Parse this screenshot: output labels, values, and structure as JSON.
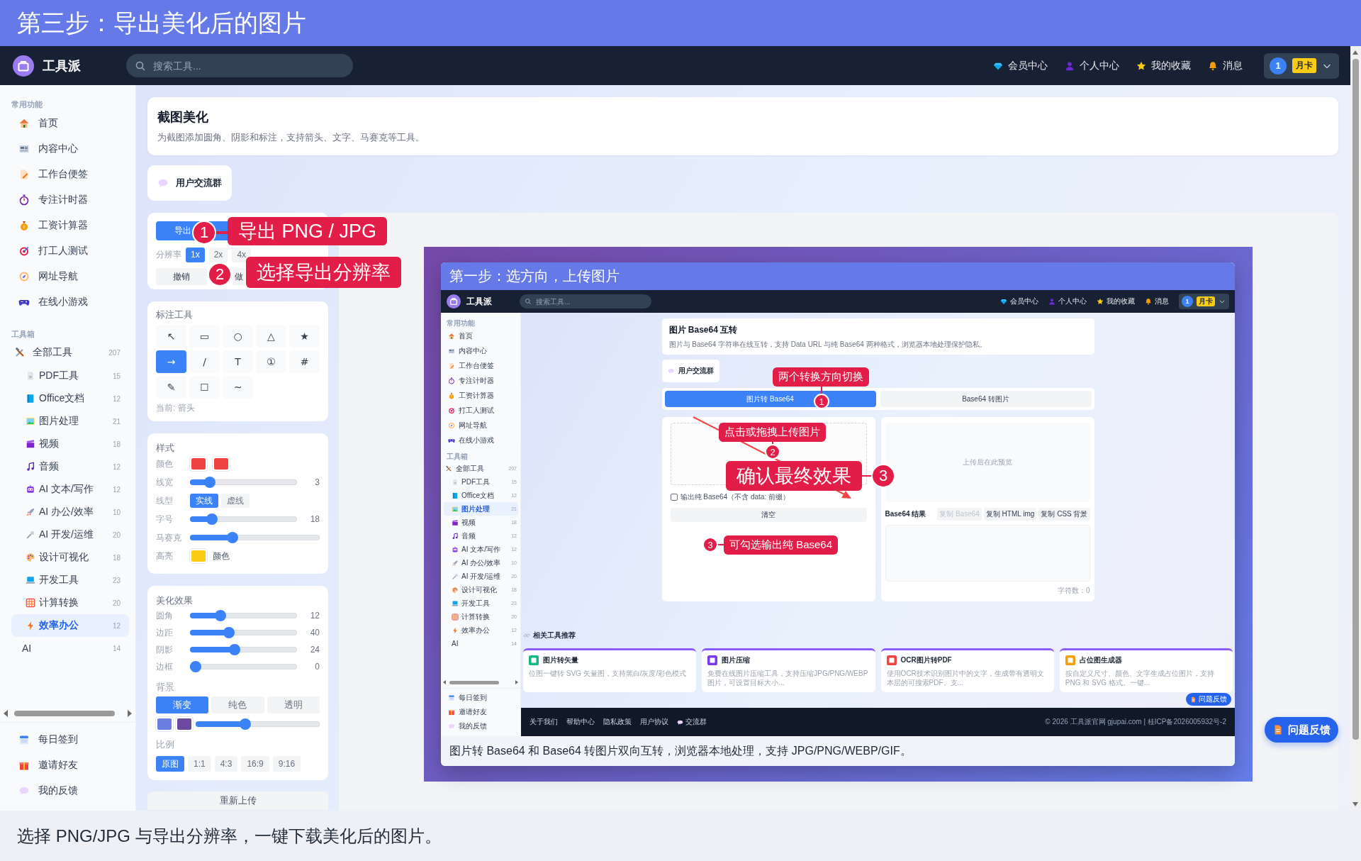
{
  "banner": {
    "title": "第三步：导出美化后的图片"
  },
  "app": {
    "brand": "工具派",
    "search": {
      "placeholder": "搜索工具..."
    },
    "nav": [
      "会员中心",
      "个人中心",
      "我的收藏",
      "消息"
    ],
    "user": {
      "avatar": "1",
      "badge": "月卡"
    }
  },
  "sidebar": {
    "sections": [
      {
        "heading": "常用功能",
        "items": [
          {
            "label": "首页",
            "selected": false
          },
          {
            "label": "内容中心",
            "selected": false
          },
          {
            "label": "工作台便签",
            "selected": false
          },
          {
            "label": "专注计时器",
            "selected": false
          },
          {
            "label": "工资计算器",
            "selected": false
          },
          {
            "label": "打工人测试",
            "selected": false
          },
          {
            "label": "网址导航",
            "selected": false
          },
          {
            "label": "在线小游戏",
            "selected": false
          }
        ]
      },
      {
        "heading": "工具箱",
        "items": [
          {
            "label": "全部工具",
            "count": "207",
            "selected": false,
            "children": [
              {
                "label": "PDF工具",
                "count": "15",
                "selected": false
              },
              {
                "label": "Office文档",
                "count": "12",
                "selected": false
              },
              {
                "label": "图片处理",
                "count": "21",
                "selected": false
              },
              {
                "label": "视频",
                "count": "18",
                "selected": false
              },
              {
                "label": "音频",
                "count": "12",
                "selected": false
              },
              {
                "label": "AI 文本/写作",
                "count": "12",
                "selected": false
              },
              {
                "label": "AI 办公/效率",
                "count": "10",
                "selected": false
              },
              {
                "label": "AI 开发/运维",
                "count": "20",
                "selected": false
              },
              {
                "label": "设计可视化",
                "count": "18",
                "selected": false
              },
              {
                "label": "开发工具",
                "count": "23",
                "selected": false
              },
              {
                "label": "计算转换",
                "count": "20",
                "selected": false
              },
              {
                "label": "效率办公",
                "count": "12",
                "selected": true
              },
              {
                "label": "AI",
                "count": "14",
                "selected": false
              }
            ]
          }
        ]
      }
    ],
    "footer_items": [
      {
        "label": "每日签到",
        "selected": false
      },
      {
        "label": "邀请好友",
        "selected": false
      },
      {
        "label": "我的反馈",
        "selected": false
      }
    ]
  },
  "page": {
    "title": "截图美化",
    "description": "为截图添加圆角、阴影和标注，支持箭头、文字、马赛克等工具。",
    "group_button": "用户交流群"
  },
  "editor": {
    "export": {
      "button": "导出",
      "resolution_label": "分辨率",
      "resolutions": [
        {
          "label": "1x",
          "selected": true
        },
        {
          "label": "2x",
          "selected": false
        },
        {
          "label": "4x",
          "selected": false
        }
      ],
      "actions": [
        "撤销",
        "做"
      ]
    },
    "annotation": {
      "title": "标注工具",
      "tools": [
        {
          "glyph": "↖",
          "selected": false
        },
        {
          "glyph": "▭",
          "selected": false
        },
        {
          "glyph": "○",
          "selected": false
        },
        {
          "glyph": "△",
          "selected": false
        },
        {
          "glyph": "★",
          "selected": false
        },
        {
          "glyph": "→",
          "selected": true
        },
        {
          "glyph": "/",
          "selected": false
        },
        {
          "glyph": "T",
          "selected": false
        },
        {
          "glyph": "①",
          "selected": false
        },
        {
          "glyph": "#",
          "selected": false
        },
        {
          "glyph": "✎",
          "selected": false
        },
        {
          "glyph": "☐",
          "selected": false
        },
        {
          "glyph": "~",
          "selected": false
        }
      ],
      "current": "当前: 箭头"
    },
    "style": {
      "title": "样式",
      "rows": [
        {
          "kind": "swatches",
          "label": "颜色",
          "swatches": [
            {
              "color": "#ef4444"
            },
            {
              "color": "#ef4444"
            }
          ]
        },
        {
          "kind": "slider",
          "label": "线宽",
          "level": 0.15,
          "value": "3"
        },
        {
          "kind": "segment",
          "label": "线型",
          "options": [
            {
              "label": "实线",
              "selected": true
            },
            {
              "label": "虚线",
              "selected": false
            }
          ]
        },
        {
          "kind": "slider",
          "label": "字号",
          "level": 0.17,
          "value": "18"
        },
        {
          "kind": "slider",
          "label": "马赛克",
          "level": 0.31
        },
        {
          "kind": "swatches",
          "label": "高亮",
          "swatches": [
            {
              "color": "#facc15"
            }
          ],
          "text": "颜色"
        }
      ]
    },
    "beauty": {
      "title": "美化效果",
      "rows": [
        {
          "kind": "slider",
          "label": "圆角",
          "level": 0.26,
          "value": "12"
        },
        {
          "kind": "slider",
          "label": "边距",
          "level": 0.35,
          "value": "40"
        },
        {
          "kind": "slider",
          "label": "阴影",
          "level": 0.41,
          "value": "24"
        },
        {
          "kind": "slider",
          "label": "边框",
          "level": 0,
          "value": "0"
        }
      ],
      "background": {
        "label": "背景",
        "options": [
          {
            "label": "渐变",
            "selected": true
          },
          {
            "label": "纯色",
            "selected": false
          },
          {
            "label": "透明",
            "selected": false
          }
        ],
        "swatches": [
          {
            "color": "#6b7fe0"
          },
          {
            "color": "#6d4aa0"
          }
        ],
        "level": 0.39
      },
      "ratio": {
        "label": "比例",
        "options": [
          {
            "label": "原图",
            "selected": true
          },
          {
            "label": "1:1",
            "selected": false
          },
          {
            "label": "4:3",
            "selected": false
          },
          {
            "label": "16:9",
            "selected": false
          },
          {
            "label": "9:16",
            "selected": false
          }
        ]
      }
    },
    "reupload": "重新上传"
  },
  "callouts": [
    {
      "number": "1",
      "text": "导出 PNG / JPG",
      "kind": "large"
    },
    {
      "number": "2",
      "text": "选择导出分辨率",
      "kind": "large"
    }
  ],
  "preview": {
    "screenshot": {
      "banner": {
        "title": "第一步：选方向，上传图片"
      },
      "app": {
        "brand": "工具派",
        "search": {
          "placeholder": "搜索工具..."
        },
        "nav": [
          "会员中心",
          "个人中心",
          "我的收藏",
          "消息"
        ],
        "user": {
          "avatar": "1",
          "badge": "月卡"
        }
      },
      "sidebar": {
        "sections": [
          {
            "heading": "常用功能",
            "items": [
              {
                "label": "首页",
                "selected": false
              },
              {
                "label": "内容中心",
                "selected": false
              },
              {
                "label": "工作台便签",
                "selected": false
              },
              {
                "label": "专注计时器",
                "selected": false
              },
              {
                "label": "工资计算器",
                "selected": false
              },
              {
                "label": "打工人测试",
                "selected": false
              },
              {
                "label": "网址导航",
                "selected": false
              },
              {
                "label": "在线小游戏",
                "selected": false
              }
            ]
          },
          {
            "heading": "工具箱",
            "items": [
              {
                "label": "全部工具",
                "count": "207",
                "selected": false,
                "children": [
                  {
                    "label": "PDF工具",
                    "count": "15",
                    "selected": false
                  },
                  {
                    "label": "Office文档",
                    "count": "12",
                    "selected": false
                  },
                  {
                    "label": "图片处理",
                    "count": "21",
                    "selected": true
                  },
                  {
                    "label": "视频",
                    "count": "18",
                    "selected": false
                  },
                  {
                    "label": "音频",
                    "count": "12",
                    "selected": false
                  },
                  {
                    "label": "AI 文本/写作",
                    "count": "12",
                    "selected": false
                  },
                  {
                    "label": "AI 办公/效率",
                    "count": "10",
                    "selected": false
                  },
                  {
                    "label": "AI 开发/运维",
                    "count": "20",
                    "selected": false
                  },
                  {
                    "label": "设计可视化",
                    "count": "18",
                    "selected": false
                  },
                  {
                    "label": "开发工具",
                    "count": "23",
                    "selected": false
                  },
                  {
                    "label": "计算转换",
                    "count": "20",
                    "selected": false
                  },
                  {
                    "label": "效率办公",
                    "count": "12",
                    "selected": false
                  },
                  {
                    "label": "AI",
                    "count": "14",
                    "selected": false
                  }
                ]
              }
            ]
          }
        ],
        "footer_items": [
          {
            "label": "每日签到",
            "selected": false
          },
          {
            "label": "邀请好友",
            "selected": false
          },
          {
            "label": "我的反馈",
            "selected": false
          }
        ]
      },
      "page": {
        "title": "图片 Base64 互转",
        "description": "图片与 Base64 字符串在线互转，支持 Data URL 与纯 Base64 两种格式，浏览器本地处理保护隐私。",
        "group_button": "用户交流群"
      },
      "tabs": [
        {
          "label": "图片转 Base64",
          "selected": true
        },
        {
          "label": "Base64 转图片",
          "selected": false
        }
      ],
      "upload": {
        "checkbox": {
          "label": "输出纯 Base64（不含 data: 前缀）",
          "checked": false
        },
        "clear_button": "清空"
      },
      "result": {
        "preview_placeholder": "上传后在此预览",
        "title": "Base64 结果",
        "buttons": [
          {
            "label": "复制 Base64",
            "disabled": true
          },
          {
            "label": "复制 HTML img",
            "disabled": false
          },
          {
            "label": "复制 CSS 背景",
            "disabled": false
          }
        ],
        "char_count": "字符数：0"
      },
      "related": {
        "title": "相关工具推荐",
        "cards": [
          {
            "title": "图片转矢量",
            "description": "位图一键转 SVG 矢量图，支持黑白/灰度/彩色模式"
          },
          {
            "title": "图片压缩",
            "description": "免费在线图片压缩工具，支持压缩JPG/PNG/WEBP图片，可设置目标大小..."
          },
          {
            "title": "OCR图片转PDF",
            "description": "使用OCR技术识别图片中的文字，生成带有透明文本层的可搜索PDF。支..."
          },
          {
            "title": "占位图生成器",
            "description": "按自定义尺寸、颜色、文字生成占位图片，支持 PNG 和 SVG 格式。一键..."
          }
        ]
      },
      "footer": {
        "links": [
          "关于我们",
          "帮助中心",
          "隐私政策",
          "用户协议",
          "交流群"
        ],
        "copyright": "© 2026 工具派官网 gjupai.com | 桂ICP备2026005932号-2"
      },
      "caption": "图片转 Base64 和 Base64 转图片双向互转，浏览器本地处理，支持 JPG/PNG/WEBP/GIF。",
      "feedback_button": "问题反馈",
      "callouts": [
        {
          "number": "1",
          "text": "两个转换方向切换",
          "kind": "small"
        },
        {
          "number": "2",
          "text": "点击或拖拽上传图片",
          "kind": "small"
        },
        {
          "number": "3",
          "text": "确认最终效果",
          "kind": "large"
        },
        {
          "number": "3",
          "text": "可勾选输出纯 Base64",
          "kind": "small"
        }
      ]
    }
  },
  "feedback_button": "问题反馈",
  "caption": "选择 PNG/JPG 与导出分辨率，一键下载美化后的图片。"
}
